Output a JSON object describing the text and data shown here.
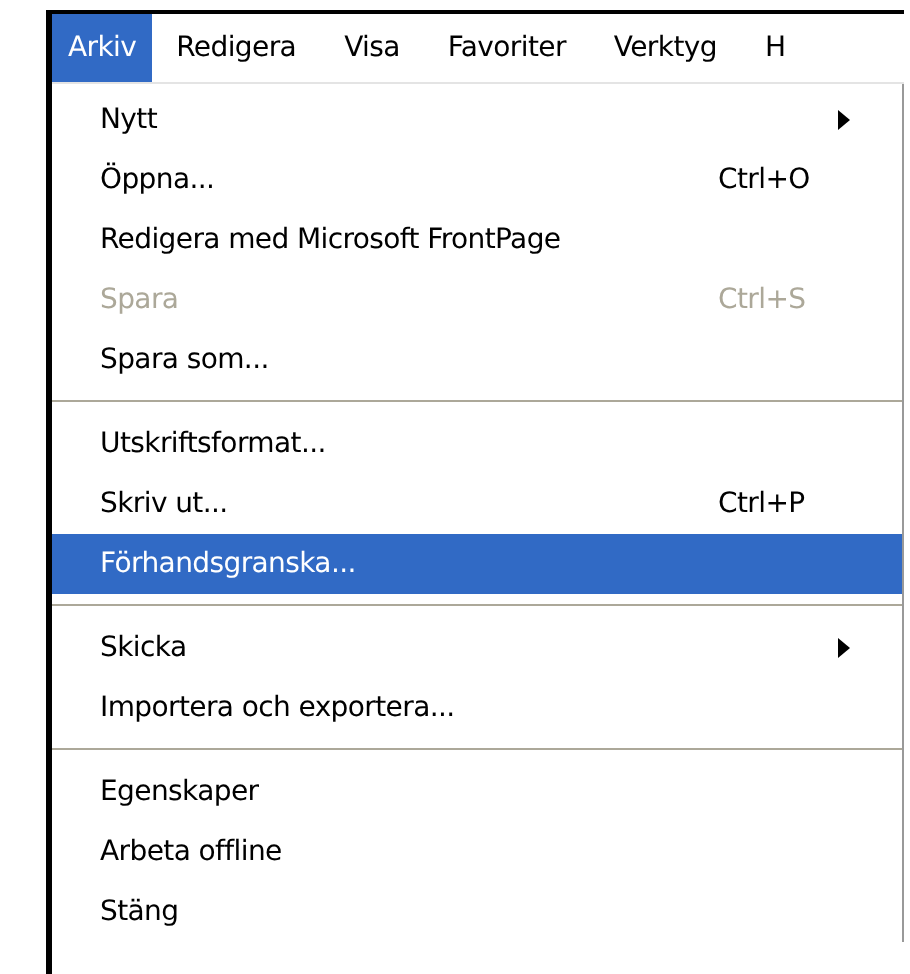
{
  "menubar": [
    {
      "label": "Arkiv",
      "selected": true
    },
    {
      "label": "Redigera",
      "selected": false
    },
    {
      "label": "Visa",
      "selected": false
    },
    {
      "label": "Favoriter",
      "selected": false
    },
    {
      "label": "Verktyg",
      "selected": false
    },
    {
      "label": "H",
      "selected": false
    }
  ],
  "menu": [
    {
      "kind": "item",
      "label": "Nytt",
      "submenu": true,
      "disabled": false,
      "selected": false
    },
    {
      "kind": "item",
      "label": "Öppna...",
      "shortcut": "Ctrl+O",
      "disabled": false,
      "selected": false
    },
    {
      "kind": "item",
      "label": "Redigera med Microsoft FrontPage",
      "disabled": false,
      "selected": false
    },
    {
      "kind": "item",
      "label": "Spara",
      "shortcut": "Ctrl+S",
      "disabled": true,
      "selected": false
    },
    {
      "kind": "item",
      "label": "Spara som...",
      "disabled": false,
      "selected": false
    },
    {
      "kind": "separator"
    },
    {
      "kind": "item",
      "label": "Utskriftsformat...",
      "disabled": false,
      "selected": false
    },
    {
      "kind": "item",
      "label": "Skriv ut...",
      "shortcut": "Ctrl+P",
      "disabled": false,
      "selected": false
    },
    {
      "kind": "item",
      "label": "Förhandsgranska...",
      "disabled": false,
      "selected": true
    },
    {
      "kind": "separator"
    },
    {
      "kind": "item",
      "label": "Skicka",
      "submenu": true,
      "disabled": false,
      "selected": false
    },
    {
      "kind": "item",
      "label": "Importera och exportera...",
      "disabled": false,
      "selected": false
    },
    {
      "kind": "separator"
    },
    {
      "kind": "item",
      "label": "Egenskaper",
      "disabled": false,
      "selected": false
    },
    {
      "kind": "item",
      "label": "Arbeta offline",
      "disabled": false,
      "selected": false
    },
    {
      "kind": "item",
      "label": "Stäng",
      "disabled": false,
      "selected": false
    }
  ]
}
